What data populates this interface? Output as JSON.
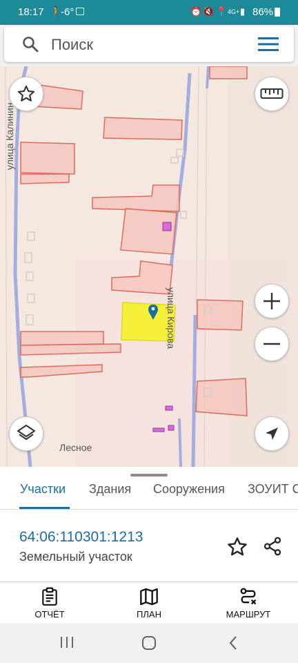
{
  "status_bar": {
    "time": "18:17",
    "temperature": "-6°",
    "network": "4G+",
    "battery": "86%"
  },
  "search": {
    "placeholder": "Поиск",
    "icon": "search-icon",
    "menu_icon": "menu-icon"
  },
  "map": {
    "street_labels": [
      "улица Калинин",
      "улица Кирова"
    ],
    "place_label": "Лесное",
    "selected_color": "#f5f03a",
    "parcel_color": "#f4c7bf",
    "parcel_border": "#e06a5a",
    "road_color": "#a3addf",
    "controls": [
      "star-icon",
      "ruler-icon",
      "zoom-in-icon",
      "zoom-out-icon",
      "layers-icon",
      "locate-icon"
    ]
  },
  "tabs": [
    {
      "label": "Участки",
      "active": true
    },
    {
      "label": "Здания",
      "active": false
    },
    {
      "label": "Сооружения",
      "active": false
    },
    {
      "label": "ЗОУИТ С",
      "active": false
    }
  ],
  "parcel": {
    "number": "64:06:110301:1213",
    "type": "Земельный участок"
  },
  "actions": [
    {
      "label": "ОТЧЁТ",
      "icon": "report-icon"
    },
    {
      "label": "ПЛАН",
      "icon": "map-plan-icon"
    },
    {
      "label": "МАРШРУТ",
      "icon": "route-icon"
    }
  ],
  "accent_color": "#1a6da0",
  "status_bar_color": "#1d8a9a"
}
